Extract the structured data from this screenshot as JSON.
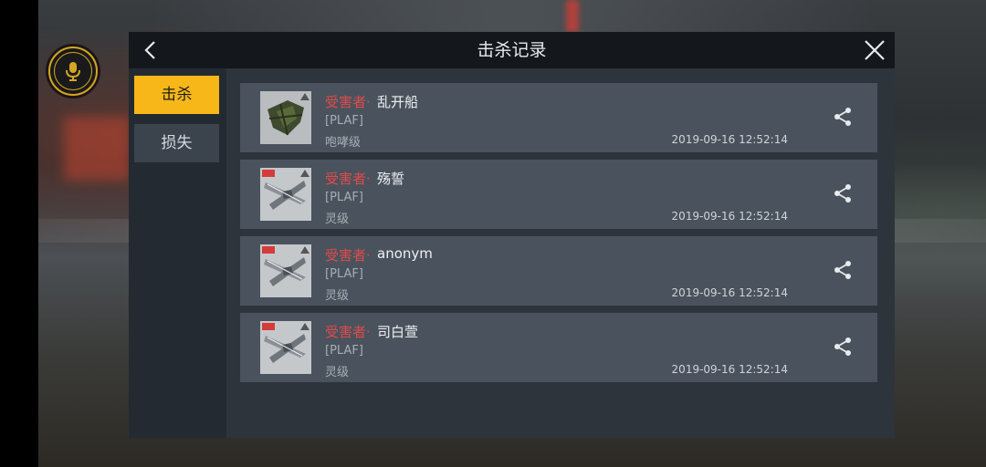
{
  "header": {
    "title": "击杀记录"
  },
  "tabs": [
    {
      "label": "击杀",
      "active": true
    },
    {
      "label": "损失",
      "active": false
    }
  ],
  "records": [
    {
      "victim_label": "受害者·",
      "victim_name": "乱开船",
      "corp": "[PLAF]",
      "ship_class": "咆哮级",
      "time": "2019-09-16 12:52:14",
      "ship_icon": "dark-frigate"
    },
    {
      "victim_label": "受害者·",
      "victim_name": "殇誓",
      "corp": "[PLAF]",
      "ship_class": "灵级",
      "time": "2019-09-16 12:52:14",
      "ship_icon": "silver-fighter"
    },
    {
      "victim_label": "受害者·",
      "victim_name": "anonym",
      "corp": "[PLAF]",
      "ship_class": "灵级",
      "time": "2019-09-16 12:52:14",
      "ship_icon": "silver-fighter"
    },
    {
      "victim_label": "受害者·",
      "victim_name": "司白萱",
      "corp": "[PLAF]",
      "ship_class": "灵级",
      "time": "2019-09-16 12:52:14",
      "ship_icon": "silver-fighter"
    }
  ],
  "colors": {
    "accent": "#f7b718",
    "victim_label": "#e14a4a",
    "mic_ring": "#d6a623"
  },
  "icons": {
    "mic": "microphone-icon",
    "back": "chevron-left-icon",
    "close": "close-icon",
    "share": "share-icon"
  }
}
